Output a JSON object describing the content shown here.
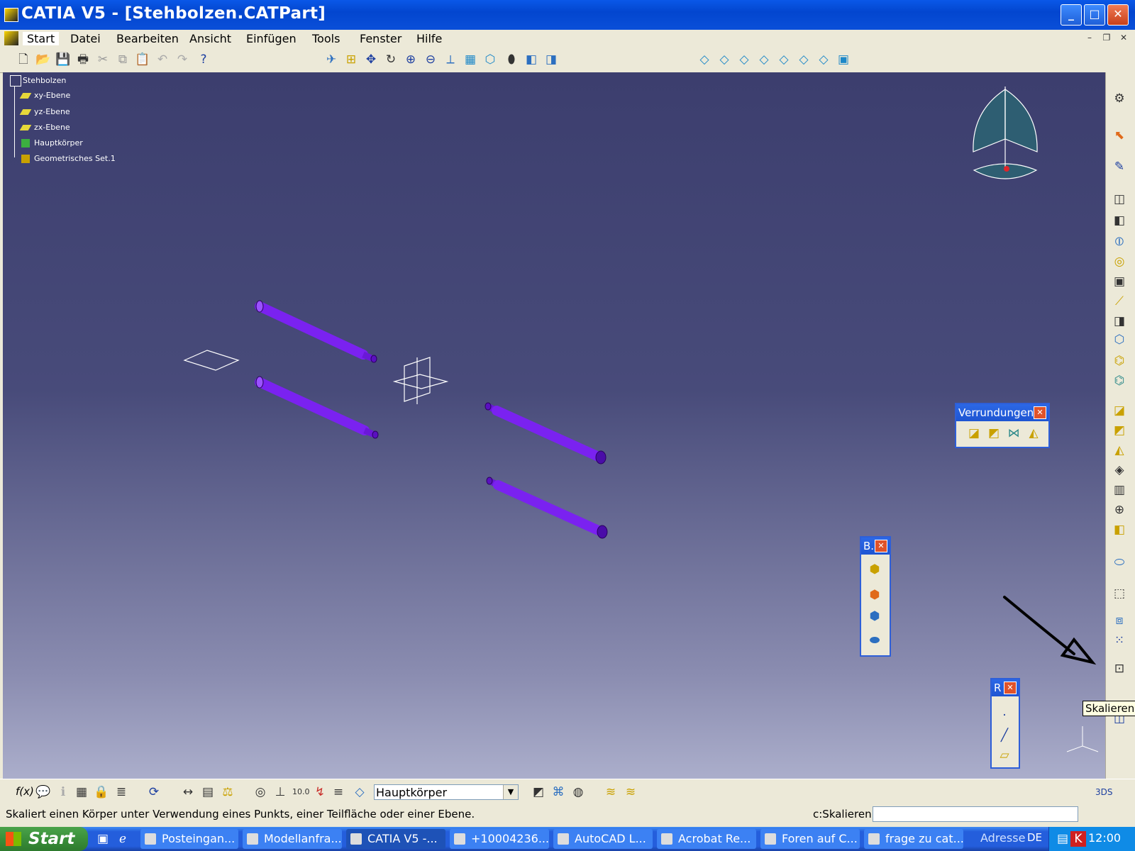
{
  "window": {
    "title": "CATIA V5 - [Stehbolzen.CATPart]",
    "buttons": [
      "minimize",
      "maximize",
      "close"
    ]
  },
  "menubar": {
    "items": [
      "Start",
      "Datei",
      "Bearbeiten",
      "Ansicht",
      "Einfügen",
      "Tools",
      "Fenster",
      "Hilfe"
    ]
  },
  "tree": {
    "root": "Stehbolzen",
    "children": [
      "xy-Ebene",
      "yz-Ebene",
      "zx-Ebene",
      "Hauptkörper",
      "Geometrisches Set.1"
    ]
  },
  "floating_toolbars": {
    "verrundungen": {
      "title": "Verrundungen"
    },
    "b": {
      "title": "B."
    },
    "r": {
      "title": "R"
    }
  },
  "tooltip": {
    "text": "Skalieren"
  },
  "bottom_toolbar": {
    "fx_label": "f(x)",
    "current_body": "Hauptkörper"
  },
  "statusbar": {
    "message": "Skaliert einen Körper unter Verwendung eines Punkts, einer Teilfläche oder einer Ebene.",
    "command_label": "c:Skalieren"
  },
  "taskbar": {
    "start_label": "Start",
    "tasks": [
      "Posteingan...",
      "Modellanfra...",
      "CATIA V5 -...",
      "+10004236...",
      "AutoCAD L...",
      "Acrobat Re...",
      "Foren auf C...",
      "frage zu cat..."
    ],
    "address_label": "Adresse",
    "language": "DE",
    "clock": "12:00"
  },
  "colors": {
    "titlebar": "#0A4FD9",
    "viewport_top": "#3C3E6E",
    "viewport_bottom": "#ABAECB",
    "bolt": "#7A22F0",
    "taskbar": "#245EDC"
  }
}
